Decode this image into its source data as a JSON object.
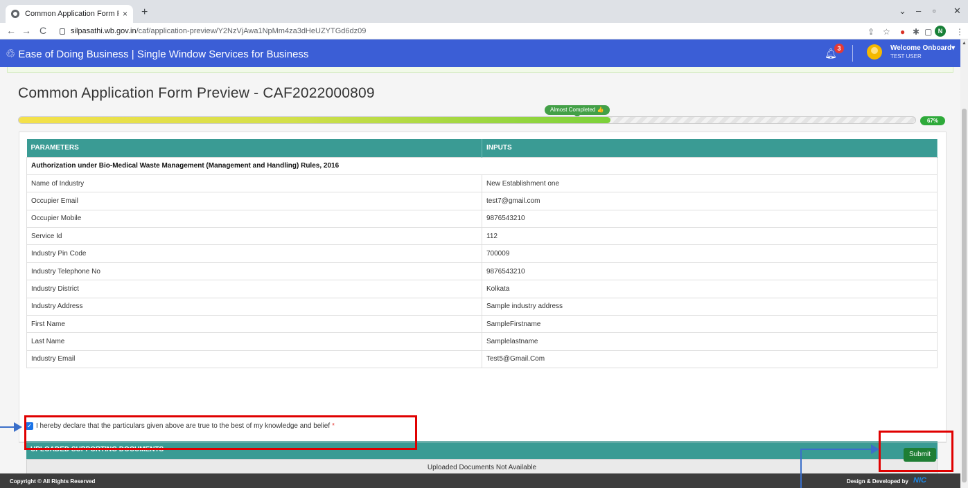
{
  "browser": {
    "tab_title": "Common Application Form Previ",
    "tab_close": "×",
    "new_tab": "+",
    "url_host": "silpasathi.wb.gov.in",
    "url_path": "/caf/application-preview/Y2NzVjAwa1NpMm4za3dHeUZYTGd6dz09",
    "profile_initial": "N",
    "nav_back": "←",
    "nav_forward": "→",
    "nav_reload": "C"
  },
  "header": {
    "brand": "Ease of Doing Business | Single Window Services for Business",
    "notification_count": "3",
    "welcome": "Welcome Onboard",
    "user": "TEST USER"
  },
  "page": {
    "title": "Common Application Form Preview - CAF2022000809",
    "progress_label": "Almost Completed 👍",
    "progress_percent": "67%",
    "progress_value": 0.66
  },
  "table": {
    "headers": [
      "PARAMETERS",
      "INPUTS"
    ],
    "section": "Authorization under Bio-Medical Waste Management (Management and Handling) Rules, 2016",
    "rows": [
      [
        "Name of Industry",
        "New Establishment one"
      ],
      [
        "Occupier Email",
        "test7@gmail.com"
      ],
      [
        "Occupier Mobile",
        "9876543210"
      ],
      [
        "Service Id",
        "112"
      ],
      [
        "Industry Pin Code",
        "700009"
      ],
      [
        "Industry Telephone No",
        "9876543210"
      ],
      [
        "Industry District",
        "Kolkata"
      ],
      [
        "Industry Address",
        "Sample industry address"
      ],
      [
        "First Name",
        "SampleFirstname"
      ],
      [
        "Last Name",
        "Samplelastname"
      ],
      [
        "Industry Email",
        "Test5@Gmail.Com"
      ]
    ]
  },
  "documents": {
    "heading": "UPLOADED SUPPORTING DOCUMENTS",
    "empty": "Uploaded Documents Not Available"
  },
  "declaration": {
    "text": "I hereby declare that the particulars given above are true to the best of my knowledge and belief",
    "required_mark": "*",
    "checked": true
  },
  "actions": {
    "submit": "Submit"
  },
  "footer": {
    "copyright": "Copyright © All Rights Reserved",
    "credit": "Design & Developed by",
    "nic": "NIC"
  },
  "colors": {
    "header_bg": "#3b5ed6",
    "table_header_bg": "#3a9b94",
    "submit_bg": "#1e7e34",
    "highlight": "#e00000",
    "arrow": "#3b6fc9"
  }
}
